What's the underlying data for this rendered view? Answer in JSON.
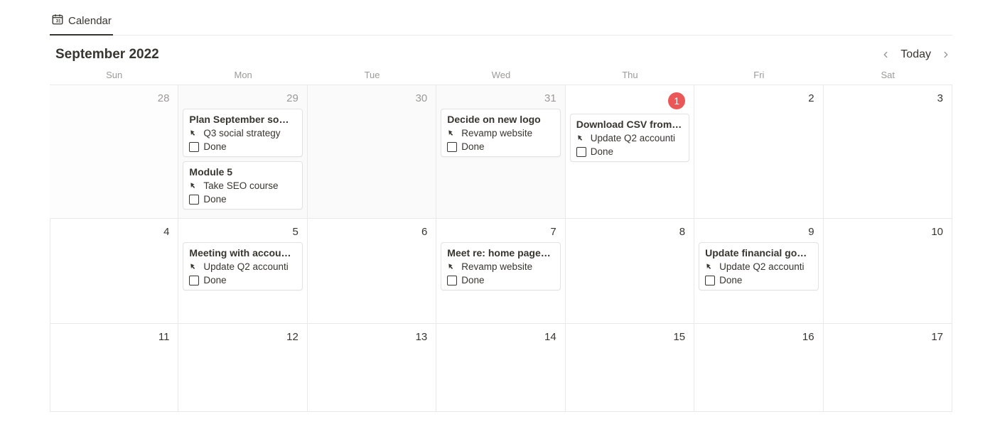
{
  "tab": {
    "label": "Calendar"
  },
  "header": {
    "month_title": "September 2022",
    "today_label": "Today"
  },
  "dow": [
    "Sun",
    "Mon",
    "Tue",
    "Wed",
    "Thu",
    "Fri",
    "Sat"
  ],
  "done_label": "Done",
  "weeks": [
    {
      "days": [
        {
          "num": "28",
          "outside": true,
          "cards": []
        },
        {
          "num": "29",
          "outside": true,
          "cards": [
            {
              "title": "Plan September so…",
              "parent": "Q3 social strategy"
            },
            {
              "title": "Module 5",
              "parent": "Take SEO course"
            }
          ]
        },
        {
          "num": "30",
          "outside": true,
          "cards": []
        },
        {
          "num": "31",
          "outside": true,
          "cards": [
            {
              "title": "Decide on new logo",
              "parent": "Revamp website"
            }
          ]
        },
        {
          "num": "1",
          "today": true,
          "cards": [
            {
              "title": "Download CSV from…",
              "parent": "Update Q2 accounti"
            }
          ]
        },
        {
          "num": "2",
          "cards": []
        },
        {
          "num": "3",
          "cards": []
        }
      ]
    },
    {
      "days": [
        {
          "num": "4",
          "cards": []
        },
        {
          "num": "5",
          "cards": [
            {
              "title": "Meeting with accou…",
              "parent": "Update Q2 accounti"
            }
          ]
        },
        {
          "num": "6",
          "cards": []
        },
        {
          "num": "7",
          "cards": [
            {
              "title": "Meet re: home page…",
              "parent": "Revamp website"
            }
          ]
        },
        {
          "num": "8",
          "cards": []
        },
        {
          "num": "9",
          "cards": [
            {
              "title": "Update financial go…",
              "parent": "Update Q2 accounti"
            }
          ]
        },
        {
          "num": "10",
          "cards": []
        }
      ]
    },
    {
      "days": [
        {
          "num": "11",
          "cards": []
        },
        {
          "num": "12",
          "cards": []
        },
        {
          "num": "13",
          "cards": []
        },
        {
          "num": "14",
          "cards": []
        },
        {
          "num": "15",
          "cards": []
        },
        {
          "num": "16",
          "cards": []
        },
        {
          "num": "17",
          "cards": []
        }
      ]
    }
  ]
}
